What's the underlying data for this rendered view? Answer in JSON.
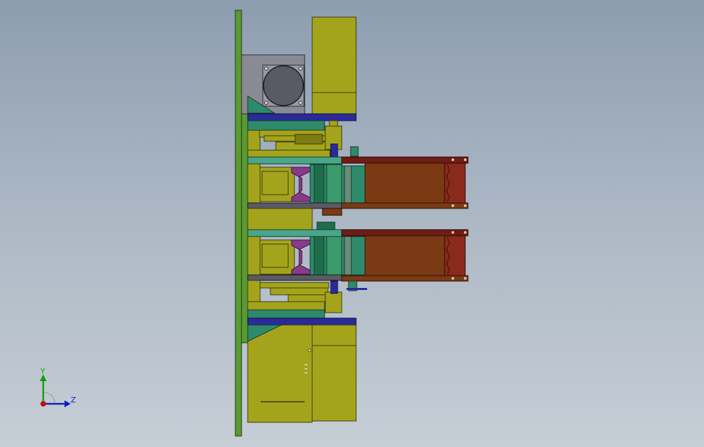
{
  "triad": {
    "y_label": "Y",
    "z_label": "Z",
    "y_color": "#10a010",
    "z_color": "#1020c0",
    "x_color": "#c01010"
  },
  "colors": {
    "background_top": "#8d9db0",
    "background_bottom": "#c6ced6",
    "plate_green": "#5a9a32",
    "olive": "#a4a41c",
    "olive_dark": "#7c7c10",
    "navy": "#2a2a9a",
    "teal": "#2e8a6a",
    "teal_light": "#4aa68a",
    "dark_green": "#1e6e4a",
    "brown": "#7a3a14",
    "maroon": "#6e1c14",
    "grey": "#8a8a94",
    "grey_dark": "#5a5a64",
    "purple": "#8a3a8a"
  }
}
